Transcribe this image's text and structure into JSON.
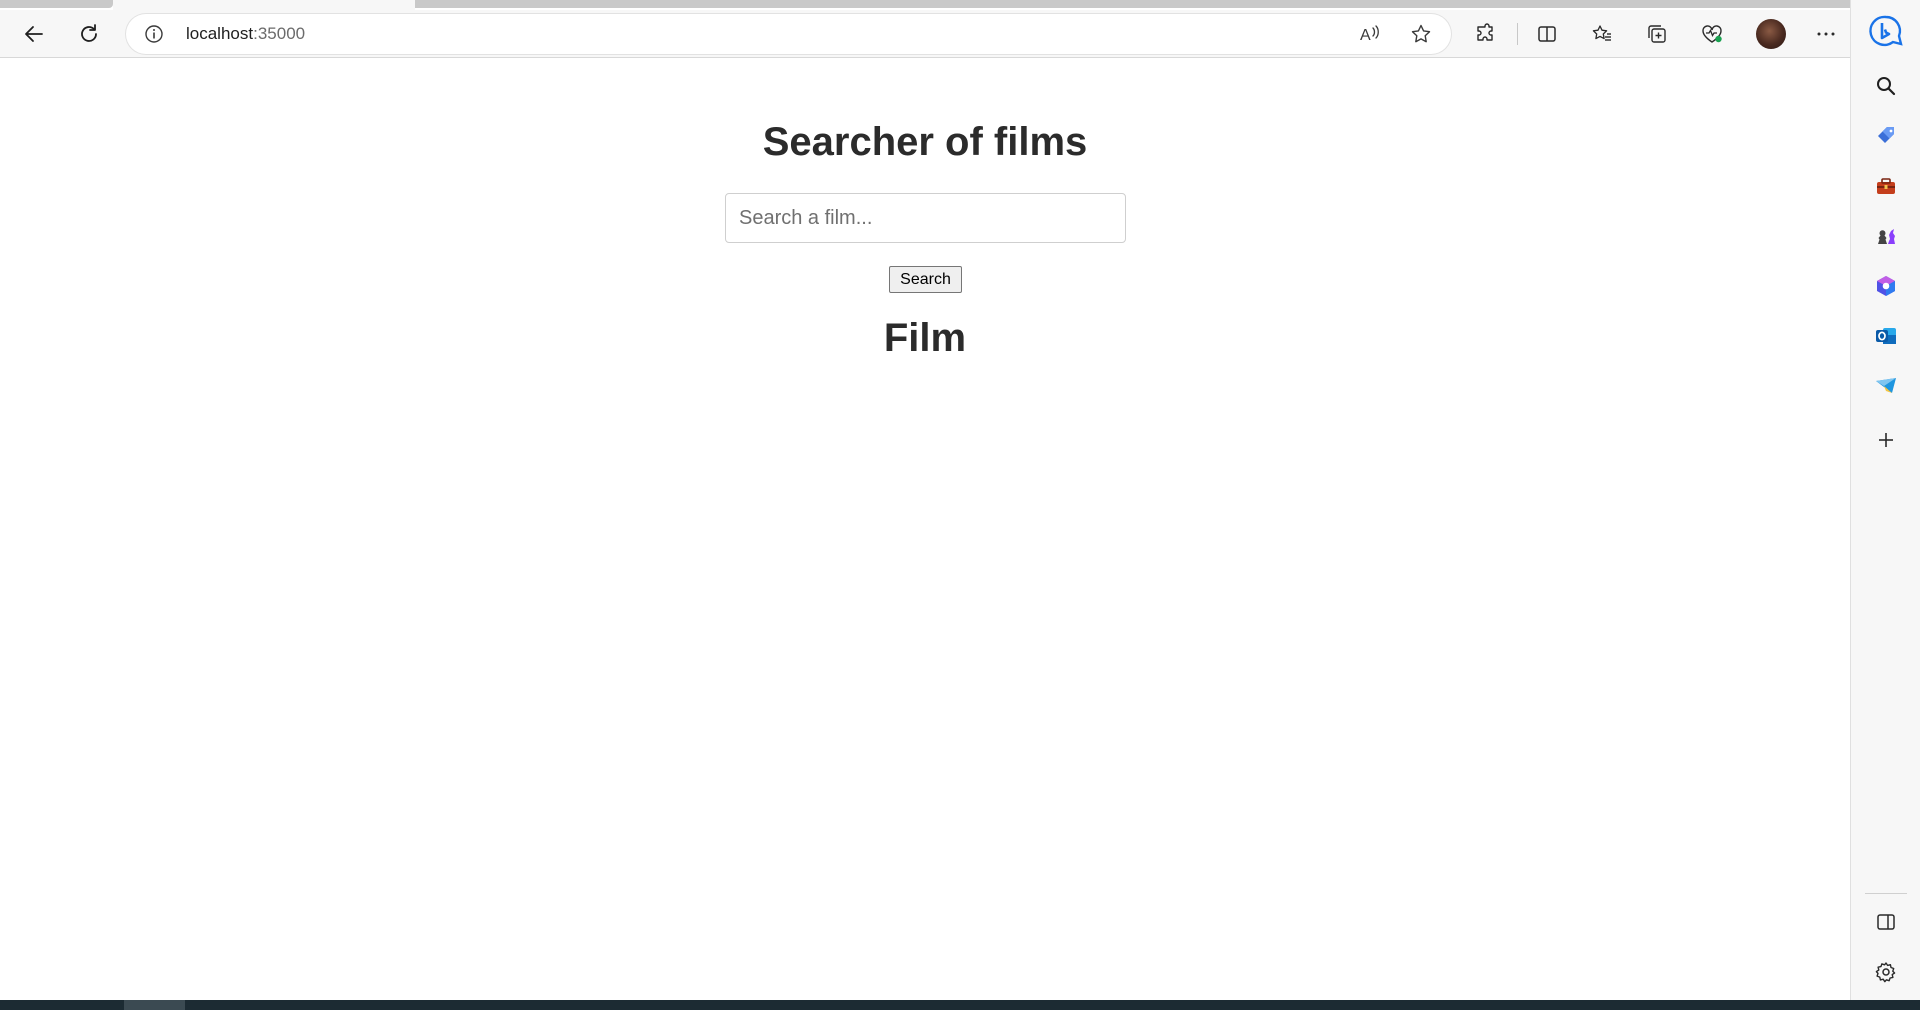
{
  "browser": {
    "address": {
      "host": "localhost",
      "port": ":35000"
    },
    "toolbar_icons": [
      "back-icon",
      "refresh-icon",
      "info-icon",
      "read-aloud-icon",
      "favorite-star-icon",
      "extensions-icon",
      "split-screen-icon",
      "favorites-icon",
      "collections-icon",
      "browser-essentials-icon",
      "profile-avatar",
      "more-icon",
      "bing-chat-icon"
    ],
    "sidebar_icons": [
      "search-icon",
      "shopping-tag-icon",
      "tools-icon",
      "games-icon",
      "office-icon",
      "outlook-icon",
      "telegram-icon",
      "add-icon",
      "sidebar-toggle-icon",
      "settings-icon"
    ],
    "colors": {
      "outlook": "#0f6cbd",
      "bing": "#1a73e8",
      "tools": "#c43e1c",
      "games": "#8a3ffc"
    }
  },
  "page": {
    "title": "Searcher of films",
    "search": {
      "placeholder": "Search a film...",
      "value": "",
      "button_label": "Search"
    },
    "section_title": "Film"
  }
}
